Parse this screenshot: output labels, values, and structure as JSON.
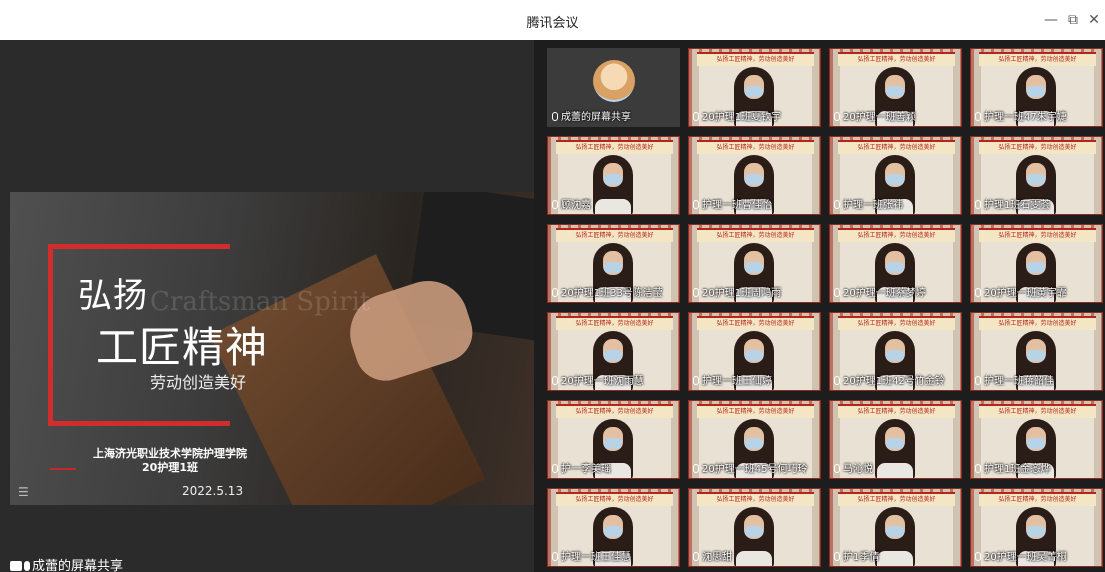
{
  "window": {
    "title": "腾讯会议",
    "minimize_glyph": "—",
    "maximize_glyph": "⧉",
    "close_glyph": "✕"
  },
  "slide": {
    "title_line1": "弘扬",
    "title_line2": "工匠精神",
    "subtitle": "劳动创造美好",
    "ghost_text": "Craftsman Spirit",
    "org_line1": "上海济光职业技术学院护理学院",
    "org_line2": "20护理1班",
    "date": "2022.5.13",
    "list_icon": "☰"
  },
  "share_caption": "成蕾的屏幕共享",
  "banner_text": "弘扬工匠精神，劳动创造美好",
  "participants": [
    {
      "name": "成蕾的屏幕共享",
      "type": "screenshare"
    },
    {
      "name": "20护理1班夏钦宇"
    },
    {
      "name": "20护理一班善颖"
    },
    {
      "name": "护理一班47朱宇婕"
    },
    {
      "name": "顾沈嘉"
    },
    {
      "name": "护理一班曹佳怡"
    },
    {
      "name": "护理一班张祎"
    },
    {
      "name": "护理1班石雯荟"
    },
    {
      "name": "20护理1班33号陈洁莹"
    },
    {
      "name": "20护理1班周鸿雨"
    },
    {
      "name": "20护理一班蔡梦婷"
    },
    {
      "name": "20护理一班黄宇霏"
    },
    {
      "name": "20护理一班沈雨慧"
    },
    {
      "name": "护理一班王仙婷"
    },
    {
      "name": "20护理1班42号竹金铃"
    },
    {
      "name": "护理一班蒋韶佳"
    },
    {
      "name": "护一李美瑶"
    },
    {
      "name": "20护理一班45号何巧玲"
    },
    {
      "name": "马沁悦"
    },
    {
      "name": "护理1班金忞烨"
    },
    {
      "name": "护理一班王佳慧"
    },
    {
      "name": "沈思甜"
    },
    {
      "name": "护1季倩"
    },
    {
      "name": "20护理一班吴菁桐"
    }
  ]
}
